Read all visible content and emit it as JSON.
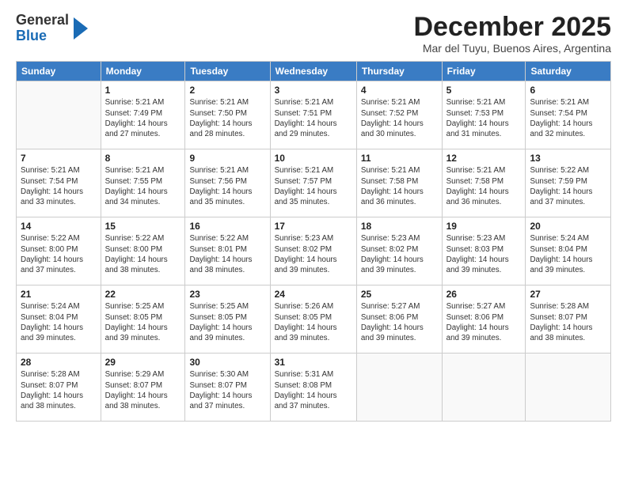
{
  "header": {
    "logo": {
      "general": "General",
      "blue": "Blue"
    },
    "title": "December 2025",
    "location": "Mar del Tuyu, Buenos Aires, Argentina"
  },
  "weekdays": [
    "Sunday",
    "Monday",
    "Tuesday",
    "Wednesday",
    "Thursday",
    "Friday",
    "Saturday"
  ],
  "weeks": [
    [
      {
        "num": "",
        "info": ""
      },
      {
        "num": "1",
        "info": "Sunrise: 5:21 AM\nSunset: 7:49 PM\nDaylight: 14 hours\nand 27 minutes."
      },
      {
        "num": "2",
        "info": "Sunrise: 5:21 AM\nSunset: 7:50 PM\nDaylight: 14 hours\nand 28 minutes."
      },
      {
        "num": "3",
        "info": "Sunrise: 5:21 AM\nSunset: 7:51 PM\nDaylight: 14 hours\nand 29 minutes."
      },
      {
        "num": "4",
        "info": "Sunrise: 5:21 AM\nSunset: 7:52 PM\nDaylight: 14 hours\nand 30 minutes."
      },
      {
        "num": "5",
        "info": "Sunrise: 5:21 AM\nSunset: 7:53 PM\nDaylight: 14 hours\nand 31 minutes."
      },
      {
        "num": "6",
        "info": "Sunrise: 5:21 AM\nSunset: 7:54 PM\nDaylight: 14 hours\nand 32 minutes."
      }
    ],
    [
      {
        "num": "7",
        "info": "Sunrise: 5:21 AM\nSunset: 7:54 PM\nDaylight: 14 hours\nand 33 minutes."
      },
      {
        "num": "8",
        "info": "Sunrise: 5:21 AM\nSunset: 7:55 PM\nDaylight: 14 hours\nand 34 minutes."
      },
      {
        "num": "9",
        "info": "Sunrise: 5:21 AM\nSunset: 7:56 PM\nDaylight: 14 hours\nand 35 minutes."
      },
      {
        "num": "10",
        "info": "Sunrise: 5:21 AM\nSunset: 7:57 PM\nDaylight: 14 hours\nand 35 minutes."
      },
      {
        "num": "11",
        "info": "Sunrise: 5:21 AM\nSunset: 7:58 PM\nDaylight: 14 hours\nand 36 minutes."
      },
      {
        "num": "12",
        "info": "Sunrise: 5:21 AM\nSunset: 7:58 PM\nDaylight: 14 hours\nand 36 minutes."
      },
      {
        "num": "13",
        "info": "Sunrise: 5:22 AM\nSunset: 7:59 PM\nDaylight: 14 hours\nand 37 minutes."
      }
    ],
    [
      {
        "num": "14",
        "info": "Sunrise: 5:22 AM\nSunset: 8:00 PM\nDaylight: 14 hours\nand 37 minutes."
      },
      {
        "num": "15",
        "info": "Sunrise: 5:22 AM\nSunset: 8:00 PM\nDaylight: 14 hours\nand 38 minutes."
      },
      {
        "num": "16",
        "info": "Sunrise: 5:22 AM\nSunset: 8:01 PM\nDaylight: 14 hours\nand 38 minutes."
      },
      {
        "num": "17",
        "info": "Sunrise: 5:23 AM\nSunset: 8:02 PM\nDaylight: 14 hours\nand 39 minutes."
      },
      {
        "num": "18",
        "info": "Sunrise: 5:23 AM\nSunset: 8:02 PM\nDaylight: 14 hours\nand 39 minutes."
      },
      {
        "num": "19",
        "info": "Sunrise: 5:23 AM\nSunset: 8:03 PM\nDaylight: 14 hours\nand 39 minutes."
      },
      {
        "num": "20",
        "info": "Sunrise: 5:24 AM\nSunset: 8:04 PM\nDaylight: 14 hours\nand 39 minutes."
      }
    ],
    [
      {
        "num": "21",
        "info": "Sunrise: 5:24 AM\nSunset: 8:04 PM\nDaylight: 14 hours\nand 39 minutes."
      },
      {
        "num": "22",
        "info": "Sunrise: 5:25 AM\nSunset: 8:05 PM\nDaylight: 14 hours\nand 39 minutes."
      },
      {
        "num": "23",
        "info": "Sunrise: 5:25 AM\nSunset: 8:05 PM\nDaylight: 14 hours\nand 39 minutes."
      },
      {
        "num": "24",
        "info": "Sunrise: 5:26 AM\nSunset: 8:05 PM\nDaylight: 14 hours\nand 39 minutes."
      },
      {
        "num": "25",
        "info": "Sunrise: 5:27 AM\nSunset: 8:06 PM\nDaylight: 14 hours\nand 39 minutes."
      },
      {
        "num": "26",
        "info": "Sunrise: 5:27 AM\nSunset: 8:06 PM\nDaylight: 14 hours\nand 39 minutes."
      },
      {
        "num": "27",
        "info": "Sunrise: 5:28 AM\nSunset: 8:07 PM\nDaylight: 14 hours\nand 38 minutes."
      }
    ],
    [
      {
        "num": "28",
        "info": "Sunrise: 5:28 AM\nSunset: 8:07 PM\nDaylight: 14 hours\nand 38 minutes."
      },
      {
        "num": "29",
        "info": "Sunrise: 5:29 AM\nSunset: 8:07 PM\nDaylight: 14 hours\nand 38 minutes."
      },
      {
        "num": "30",
        "info": "Sunrise: 5:30 AM\nSunset: 8:07 PM\nDaylight: 14 hours\nand 37 minutes."
      },
      {
        "num": "31",
        "info": "Sunrise: 5:31 AM\nSunset: 8:08 PM\nDaylight: 14 hours\nand 37 minutes."
      },
      {
        "num": "",
        "info": ""
      },
      {
        "num": "",
        "info": ""
      },
      {
        "num": "",
        "info": ""
      }
    ]
  ]
}
